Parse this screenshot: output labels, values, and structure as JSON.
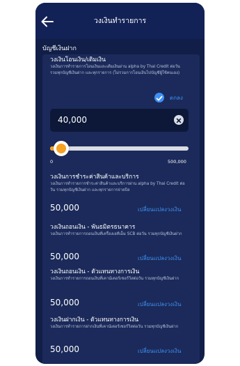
{
  "header": {
    "title": "วงเงินทำรายการ"
  },
  "section_title": "บัญชีเงินฝาก",
  "transfer_limit": {
    "title": "วงเงินโอนเงิน/เติมเงิน",
    "description": "วงเงินการทำรายการโอนเงินและเติมเงินผ่าน alpha by Thai Credit ต่อวัน รวมทุกบัญชีเงินฝาก และทุกรายการ (ไม่รวมการโอนเงินไปบัญชีผู้ใช้คนเอง)",
    "confirm_label": "ตกลง",
    "value": "40,000",
    "slider": {
      "min_label": "0",
      "max_label": "500,000",
      "fraction": 0.08
    }
  },
  "limits": [
    {
      "title": "วงเงินการชำระค่าสินค้าและบริการ",
      "description": "วงเงินการทำรายการชำระค่าสินค้าและบริการผ่าน alpha by Thai Credit ต่อวัน รวมทุกบัญชีเงินฝาก และทุกรายการจ่ายบิล",
      "amount": "50,000",
      "change_label": "เปลี่ยนแปลงวงเงิน"
    },
    {
      "title": "วงเงินถอนเงิน - พันธมิตรธนาคาร",
      "description": "วงเงินการทำรายการถอนเงินที่เครื่องเอทีเอ็ม SCB ต่อวัน รวมทุกบัญชีเงินฝาก",
      "amount": "50,000",
      "change_label": "เปลี่ยนแปลงวงเงิน"
    },
    {
      "title": "วงเงินถอนเงิน - ตัวแทนทางการเงิน",
      "description": "วงเงินการทำรายการถอนเงินที่เคาน์เตอร์เซอร์วิสต่อวัน รวมทุกบัญชีเงินฝาก",
      "amount": "50,000",
      "change_label": "เปลี่ยนแปลงวงเงิน"
    },
    {
      "title": "วงเงินฝากเงิน - ตัวแทนทางการเงิน",
      "description": "วงเงินการทำรายการฝากเงินที่เคาน์เตอร์เซอร์วิสต่อวัน รวมทุกบัญชีเงินฝาก",
      "amount": "50,000",
      "change_label": "เปลี่ยนแปลงวงเงิน"
    }
  ],
  "colors": {
    "background": "#101e48",
    "card": "#1b2a5a",
    "accent_blue": "#3f8ff2",
    "slider_orange": "#f5a123"
  }
}
